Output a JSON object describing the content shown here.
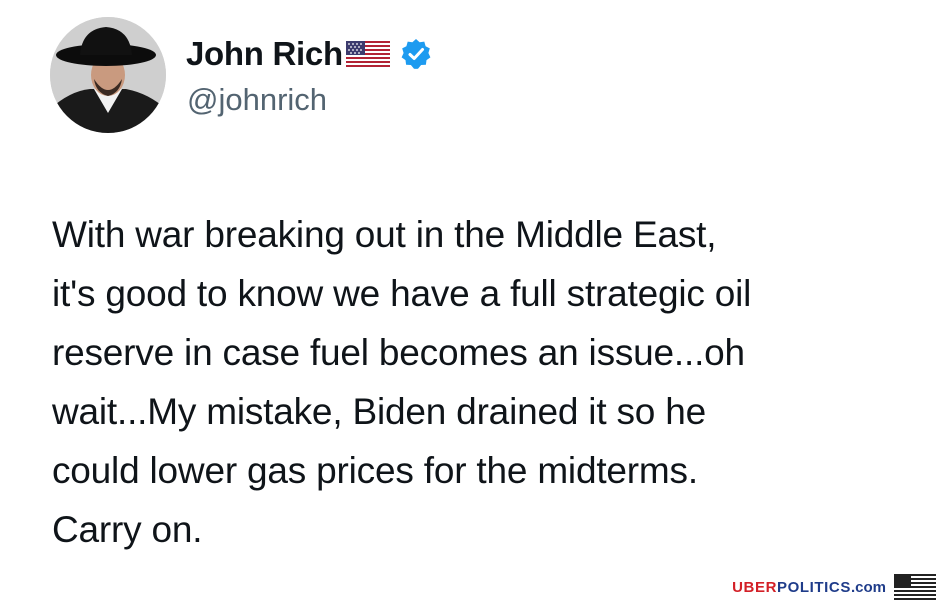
{
  "tweet": {
    "author": {
      "display_name": "John Rich",
      "handle": "@johnrich",
      "flag_icon": "us-flag-icon",
      "verified_icon": "verified-badge-icon",
      "verified_color": "#1d9bf0"
    },
    "body": "With war breaking out in the Middle East,\nit's good to know we have a full strategic oil\nreserve in case fuel becomes an issue...oh\nwait...My mistake, Biden drained it so he\ncould lower gas prices for the midterms.\nCarry on."
  },
  "watermark": {
    "part1": "UBER",
    "part2": "POLITICS",
    "part3": ".com",
    "part1_color": "#d32027",
    "part2_color": "#1f3c8a",
    "flag_icon": "us-flag-icon"
  }
}
